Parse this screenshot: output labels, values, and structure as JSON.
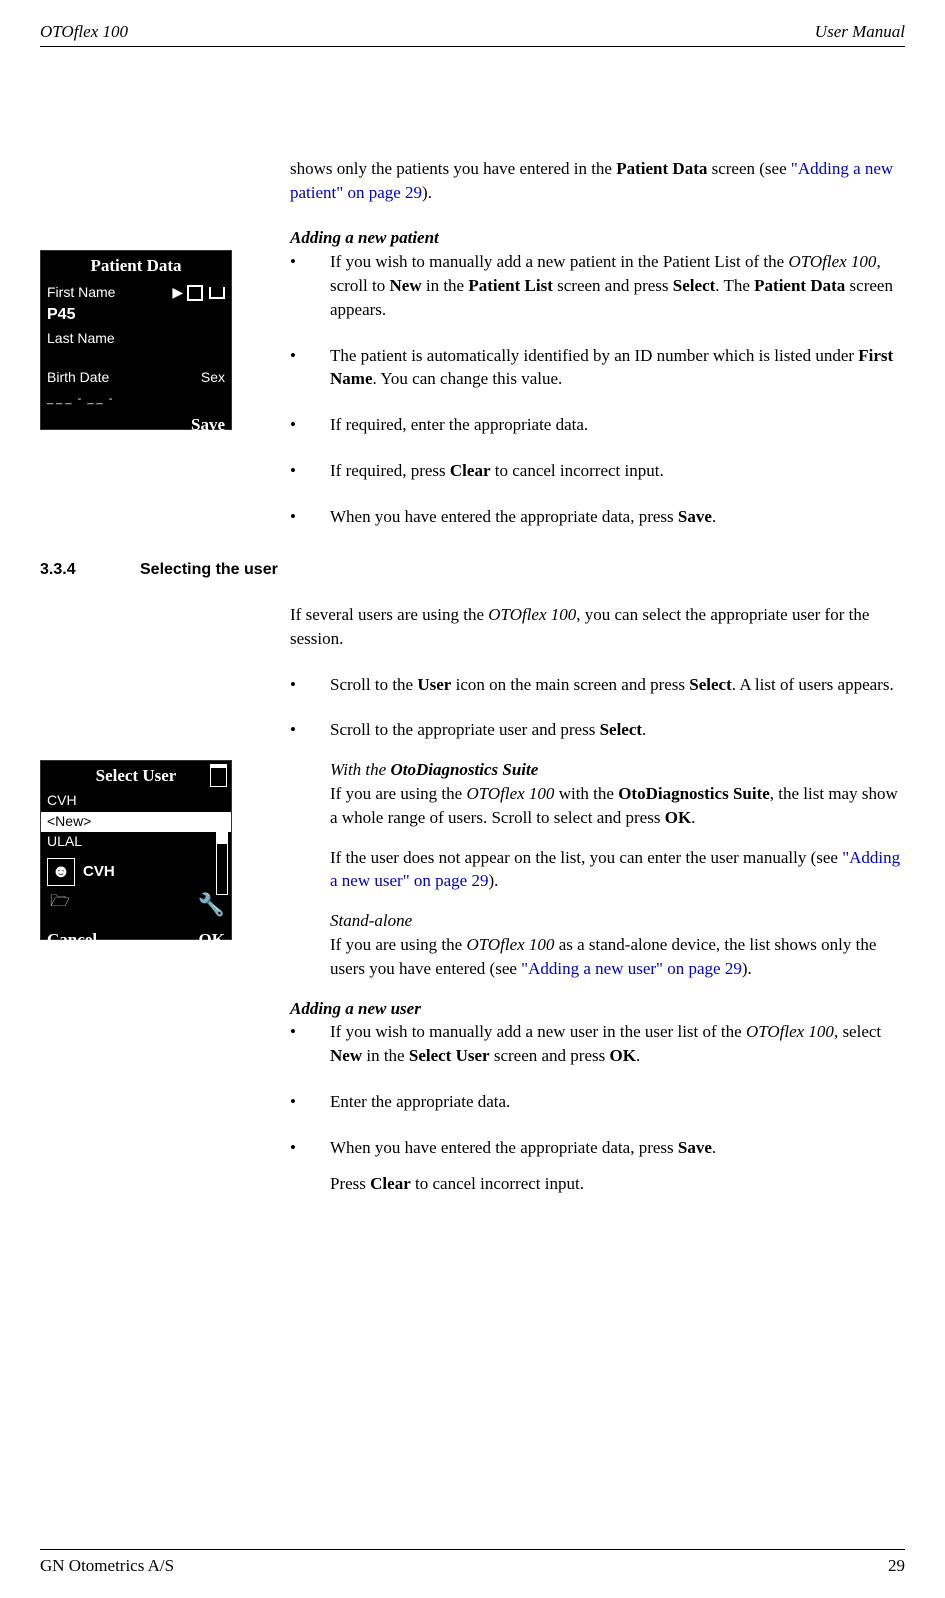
{
  "header": {
    "left": "OTOflex 100",
    "right": "User Manual"
  },
  "intro_text": {
    "part1": "shows only the patients you have entered in the ",
    "bold1": "Patient Data",
    "part2": " screen (see  ",
    "link1": "\"Adding a new patient\" on page 29",
    "part3": ")."
  },
  "adding_patient_heading": "Adding a new patient",
  "adding_patient_bullets": {
    "b1_p1": "If you wish to manually add a new patient in the Patient List of the ",
    "b1_i1": "OTOflex 100",
    "b1_p2": ", scroll to ",
    "b1_b1": "New",
    "b1_p3": " in the ",
    "b1_b2": "Patient List",
    "b1_p4": " screen and press ",
    "b1_b3": "Select",
    "b1_p5": ". The ",
    "b1_b4": "Patient Data",
    "b1_p6": " screen appears.",
    "b2_p1": "The patient is automatically identified by an ID number which is listed under ",
    "b2_b1": "First Name",
    "b2_p2": ". You can change this value.",
    "b3": "If required, enter the appropriate data.",
    "b4_p1": "If required, press ",
    "b4_b1": "Clear",
    "b4_p2": " to cancel incorrect input.",
    "b5_p1": "When you have entered the appropriate data, press ",
    "b5_b1": "Save",
    "b5_p2": "."
  },
  "section_334": {
    "num": "3.3.4",
    "title": "Selecting the user",
    "intro_p1": "If several users are using the ",
    "intro_i1": "OTOflex 100",
    "intro_p2": ", you can select the appropriate user for the session.",
    "b1_p1": "Scroll to the ",
    "b1_b1": "User",
    "b1_p2": " icon on the main screen and press ",
    "b1_b2": "Select",
    "b1_p3": ". A list of users appears.",
    "b2_p1": "Scroll to the appropriate user and press ",
    "b2_b1": "Select",
    "b2_p2": ".",
    "sub1_heading_i": "With the ",
    "sub1_heading_b": "OtoDiagnostics Suite",
    "sub1_p1": "If you are using the ",
    "sub1_i1": "OTOflex 100",
    "sub1_p2": " with the ",
    "sub1_b1": "OtoDiagnostics Suite",
    "sub1_p3": ", the list may show a whole range of users. Scroll to select and press ",
    "sub1_b2": "OK",
    "sub1_p4": ".",
    "sub2_p1": "If the user does not appear on the list, you can enter the user manually (see  ",
    "sub2_link1": "\"Adding a new user\" on page 29",
    "sub2_p2": ").",
    "sub3_i1": "Stand-alone",
    "sub3_p1": "If you are using the ",
    "sub3_i2": "OTOflex 100",
    "sub3_p2": " as a stand-alone device, the list shows only the users you have entered (see  ",
    "sub3_link1": "\"Adding a new user\" on page 29",
    "sub3_p3": ")."
  },
  "adding_user_heading": "Adding a new user",
  "adding_user": {
    "b1_p1": "If you wish to manually add a new user in the user list of the ",
    "b1_i1": "OTOflex 100",
    "b1_p2": ", select ",
    "b1_b1": "New",
    "b1_p3": " in the ",
    "b1_b2": "Select User",
    "b1_p4": " screen and press ",
    "b1_b3": "OK",
    "b1_p5": ".",
    "b2": "Enter the appropriate data.",
    "b3_p1": "When you have entered the appropriate data, press ",
    "b3_b1": "Save",
    "b3_p2": ".",
    "last_p1": "Press ",
    "last_b1": "Clear",
    "last_p2": " to cancel incorrect input."
  },
  "screenshot1": {
    "title": "Patient Data",
    "first_name": "First Name",
    "pid": "P45",
    "last_name": "Last Name",
    "birth_date": "Birth Date",
    "sex": "Sex",
    "save": "Save"
  },
  "screenshot2": {
    "title": "Select User",
    "item1": "CVH",
    "item2": "<New>",
    "item3": "ULAL",
    "item4": "CVH",
    "cancel": "Cancel",
    "ok": "OK"
  },
  "footer": {
    "left": "GN Otometrics A/S",
    "right": "29"
  }
}
